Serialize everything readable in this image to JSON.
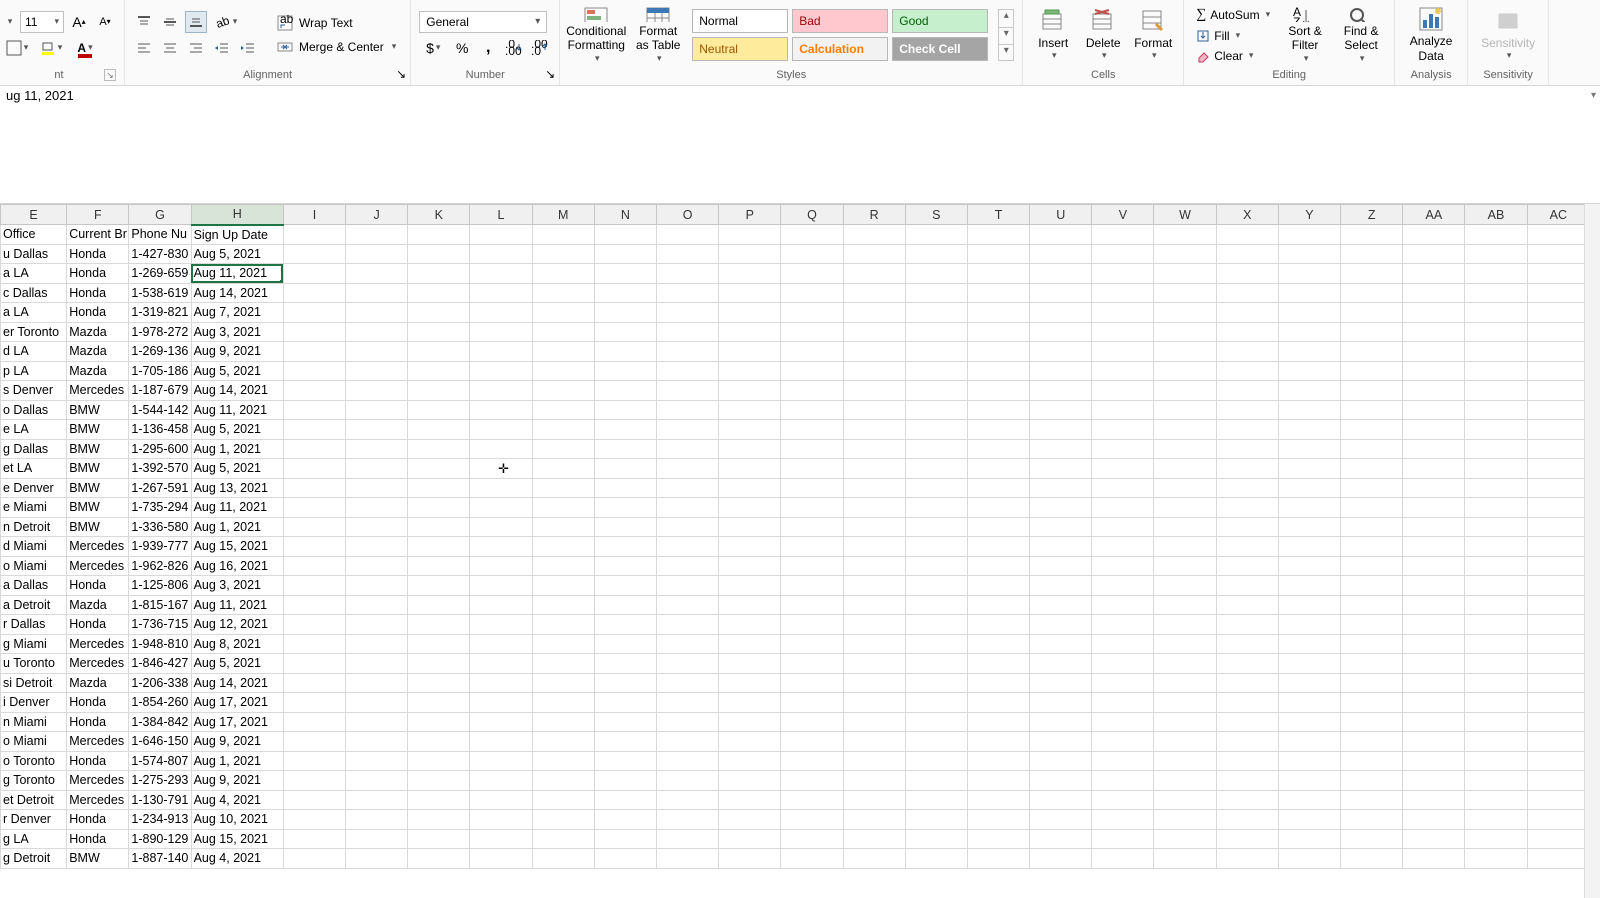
{
  "ribbon": {
    "font": {
      "size": "11",
      "grow_icon": "A",
      "shrink_icon": "A"
    },
    "alignment": {
      "label": "Alignment",
      "wrap_text": "Wrap Text",
      "merge_center": "Merge & Center"
    },
    "number": {
      "label": "Number",
      "format": "General"
    },
    "styles": {
      "label": "Styles",
      "conditional_formatting": "Conditional Formatting",
      "format_as_table": "Format as Table",
      "cells": {
        "normal": "Normal",
        "bad": "Bad",
        "good": "Good",
        "neutral": "Neutral",
        "calculation": "Calculation",
        "check_cell": "Check Cell"
      }
    },
    "cells": {
      "label": "Cells",
      "insert": "Insert",
      "delete": "Delete",
      "format": "Format"
    },
    "editing": {
      "label": "Editing",
      "autosum": "AutoSum",
      "fill": "Fill",
      "clear": "Clear",
      "sort_filter": "Sort & Filter",
      "find_select": "Find & Select"
    },
    "analysis": {
      "label": "Analysis",
      "analyze_data": "Analyze Data"
    },
    "sensitivity": {
      "label": "Sensitivity",
      "button": "Sensitivity"
    }
  },
  "formula_bar": {
    "value": "ug 11, 2021"
  },
  "columns": [
    "E",
    "F",
    "G",
    "H",
    "I",
    "J",
    "K",
    "L",
    "M",
    "N",
    "O",
    "P",
    "Q",
    "R",
    "S",
    "T",
    "U",
    "V",
    "W",
    "X",
    "Y",
    "Z",
    "AA",
    "AB",
    "AC"
  ],
  "selected_col": "H",
  "headers": {
    "E": "Office",
    "F": "Current Br",
    "G": "Phone Nu",
    "H": "Sign Up Date"
  },
  "rows": [
    {
      "E": "u Dallas",
      "F": "Honda",
      "G": "1-427-830",
      "H": "Aug 5, 2021"
    },
    {
      "E": "a LA",
      "F": "Honda",
      "G": "1-269-659",
      "H": "Aug 11, 2021",
      "selected": true
    },
    {
      "E": "c Dallas",
      "F": "Honda",
      "G": "1-538-619",
      "H": "Aug 14, 2021"
    },
    {
      "E": "a LA",
      "F": "Honda",
      "G": "1-319-821",
      "H": "Aug 7, 2021"
    },
    {
      "E": "er Toronto",
      "F": "Mazda",
      "G": "1-978-272",
      "H": "Aug 3, 2021"
    },
    {
      "E": "d LA",
      "F": "Mazda",
      "G": "1-269-136",
      "H": "Aug 9, 2021"
    },
    {
      "E": "p LA",
      "F": "Mazda",
      "G": "1-705-186",
      "H": "Aug 5, 2021"
    },
    {
      "E": "s Denver",
      "F": "Mercedes",
      "G": "1-187-679",
      "H": "Aug 14, 2021"
    },
    {
      "E": "o Dallas",
      "F": "BMW",
      "G": "1-544-142",
      "H": "Aug 11, 2021"
    },
    {
      "E": "e LA",
      "F": "BMW",
      "G": "1-136-458",
      "H": "Aug 5, 2021"
    },
    {
      "E": "g Dallas",
      "F": "BMW",
      "G": "1-295-600",
      "H": "Aug 1, 2021"
    },
    {
      "E": "et LA",
      "F": "BMW",
      "G": "1-392-570",
      "H": "Aug 5, 2021"
    },
    {
      "E": "e Denver",
      "F": "BMW",
      "G": "1-267-591",
      "H": "Aug 13, 2021"
    },
    {
      "E": "e Miami",
      "F": "BMW",
      "G": "1-735-294",
      "H": "Aug 11, 2021"
    },
    {
      "E": "n Detroit",
      "F": "BMW",
      "G": "1-336-580",
      "H": "Aug 1, 2021"
    },
    {
      "E": "d Miami",
      "F": "Mercedes",
      "G": "1-939-777",
      "H": "Aug 15, 2021"
    },
    {
      "E": "o Miami",
      "F": "Mercedes",
      "G": "1-962-826",
      "H": "Aug 16, 2021"
    },
    {
      "E": "a Dallas",
      "F": "Honda",
      "G": "1-125-806",
      "H": "Aug 3, 2021"
    },
    {
      "E": "a Detroit",
      "F": "Mazda",
      "G": "1-815-167",
      "H": "Aug 11, 2021"
    },
    {
      "E": "r Dallas",
      "F": "Honda",
      "G": "1-736-715",
      "H": "Aug 12, 2021"
    },
    {
      "E": "g Miami",
      "F": "Mercedes",
      "G": "1-948-810",
      "H": "Aug 8, 2021"
    },
    {
      "E": "u Toronto",
      "F": "Mercedes",
      "G": "1-846-427",
      "H": "Aug 5, 2021"
    },
    {
      "E": "si Detroit",
      "F": "Mazda",
      "G": "1-206-338",
      "H": "Aug 14, 2021"
    },
    {
      "E": "i Denver",
      "F": "Honda",
      "G": "1-854-260",
      "H": "Aug 17, 2021"
    },
    {
      "E": "n Miami",
      "F": "Honda",
      "G": "1-384-842",
      "H": "Aug 17, 2021"
    },
    {
      "E": "o Miami",
      "F": "Mercedes",
      "G": "1-646-150",
      "H": "Aug 9, 2021"
    },
    {
      "E": "o Toronto",
      "F": "Honda",
      "G": "1-574-807",
      "H": "Aug 1, 2021"
    },
    {
      "E": "g Toronto",
      "F": "Mercedes",
      "G": "1-275-293",
      "H": "Aug 9, 2021"
    },
    {
      "E": "et Detroit",
      "F": "Mercedes",
      "G": "1-130-791",
      "H": "Aug 4, 2021"
    },
    {
      "E": "r Denver",
      "F": "Honda",
      "G": "1-234-913",
      "H": "Aug 10, 2021"
    },
    {
      "E": "g LA",
      "F": "Honda",
      "G": "1-890-129",
      "H": "Aug 15, 2021"
    },
    {
      "E": "g Detroit",
      "F": "BMW",
      "G": "1-887-140",
      "H": "Aug 4, 2021"
    }
  ],
  "col_widths": {
    "E": 66,
    "F": 62,
    "G": 62,
    "H": 92
  }
}
